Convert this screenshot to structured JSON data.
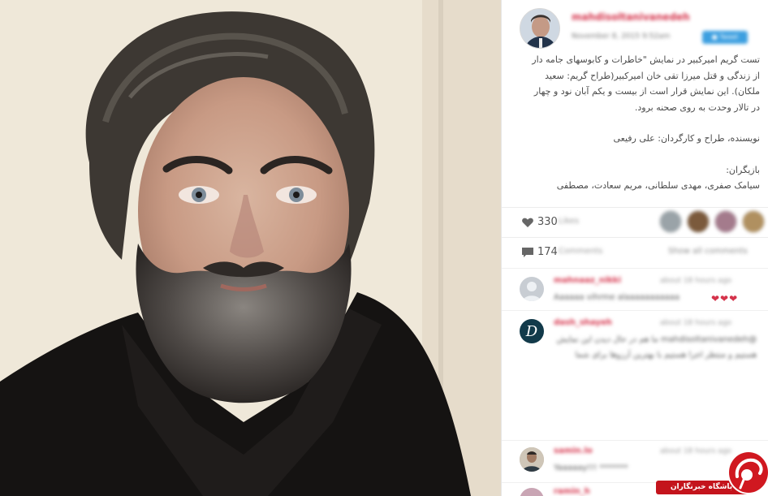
{
  "post": {
    "username": "mahdisoltanivanedeh",
    "date": "November 8, 2015 9:52am",
    "share_label": "Tweet",
    "caption_lines": [
      "تست گریم امیرکبیر در نمایش \"خاطرات و کابوسهای جامه دار",
      "از زندگی و قتل میرزا تقی خان امیرکبیر(طراح گریم: سعید",
      "ملکان). این نمایش قرار است از بیست و یکم آبان نود و چهار",
      "در تالار وحدت به روی صحنه برود."
    ],
    "credit_line": "نویسنده، طراح و کارگردان: علی رفیعی",
    "cast_title": "بازیگران:",
    "cast_line": "سیامک صفری، مهدی سلطانی، مریم سعادت، مصطفی"
  },
  "stats": {
    "likes_count": "330",
    "likes_label": "Likes",
    "comments_count": "174",
    "comments_label": "Comments",
    "show_all_label": "Show all comments"
  },
  "comments": [
    {
      "user": "mahnaaz_nikki",
      "time": "about 18 hours ago",
      "text": "Aaaaaa vihrme alaaaaaaaaaaa"
    },
    {
      "user": "dash_shayeh",
      "time": "about 18 hours ago",
      "text": "@mahdisoltanivanedeh ما هم در حال دیدن این نمایش هستیم و منتظر اجرا هستیم با بهترین آرزوها برای شما"
    },
    {
      "user": "samin.lo",
      "time": "about 18 hours ago",
      "text": "Yaaaaay!!! *******"
    },
    {
      "user": "ramin_h",
      "time": "about 18 hours ago",
      "text": ""
    }
  ],
  "watermark": {
    "site_name": "باشگاه خبرنگاران"
  },
  "colors": {
    "username": "#d5334b",
    "brand_red": "#c4141c",
    "twitter": "#3c9fe0"
  }
}
